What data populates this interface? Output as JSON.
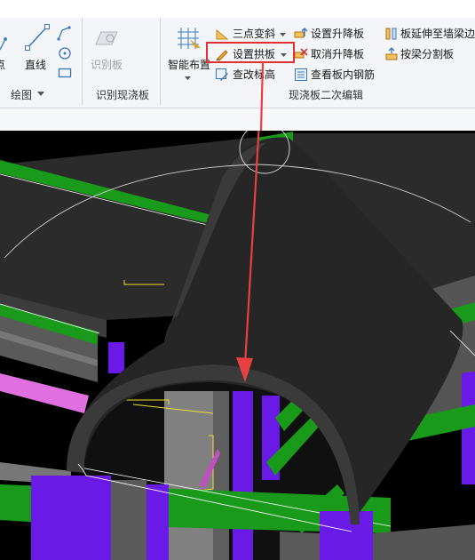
{
  "ribbon": {
    "draw_group": {
      "point_label": "点",
      "line_label": "直线",
      "group_label": "绘图"
    },
    "identify_group": {
      "identify_slab_label": "识别板",
      "group_label": "识别现浇板"
    },
    "edit_group": {
      "smart_layout_label": "智能布置",
      "three_point_slope_label": "三点变斜",
      "set_arch_slab_label": "设置拱板",
      "check_elevation_label": "查改标高",
      "set_lift_slab_label": "设置升降板",
      "cancel_lift_slab_label": "取消升降板",
      "view_slab_rebar_label": "查看板内钢筋",
      "extend_slab_label": "板延伸至墙梁边",
      "split_by_beam_label": "按梁分割板",
      "group_label": "现浇板二次编辑"
    }
  },
  "colors": {
    "highlight": "#e03030",
    "arrow": "#e84040",
    "beam_green": "#1a9a1a",
    "column_purple": "#6a1ae6",
    "arch": "#262626"
  }
}
